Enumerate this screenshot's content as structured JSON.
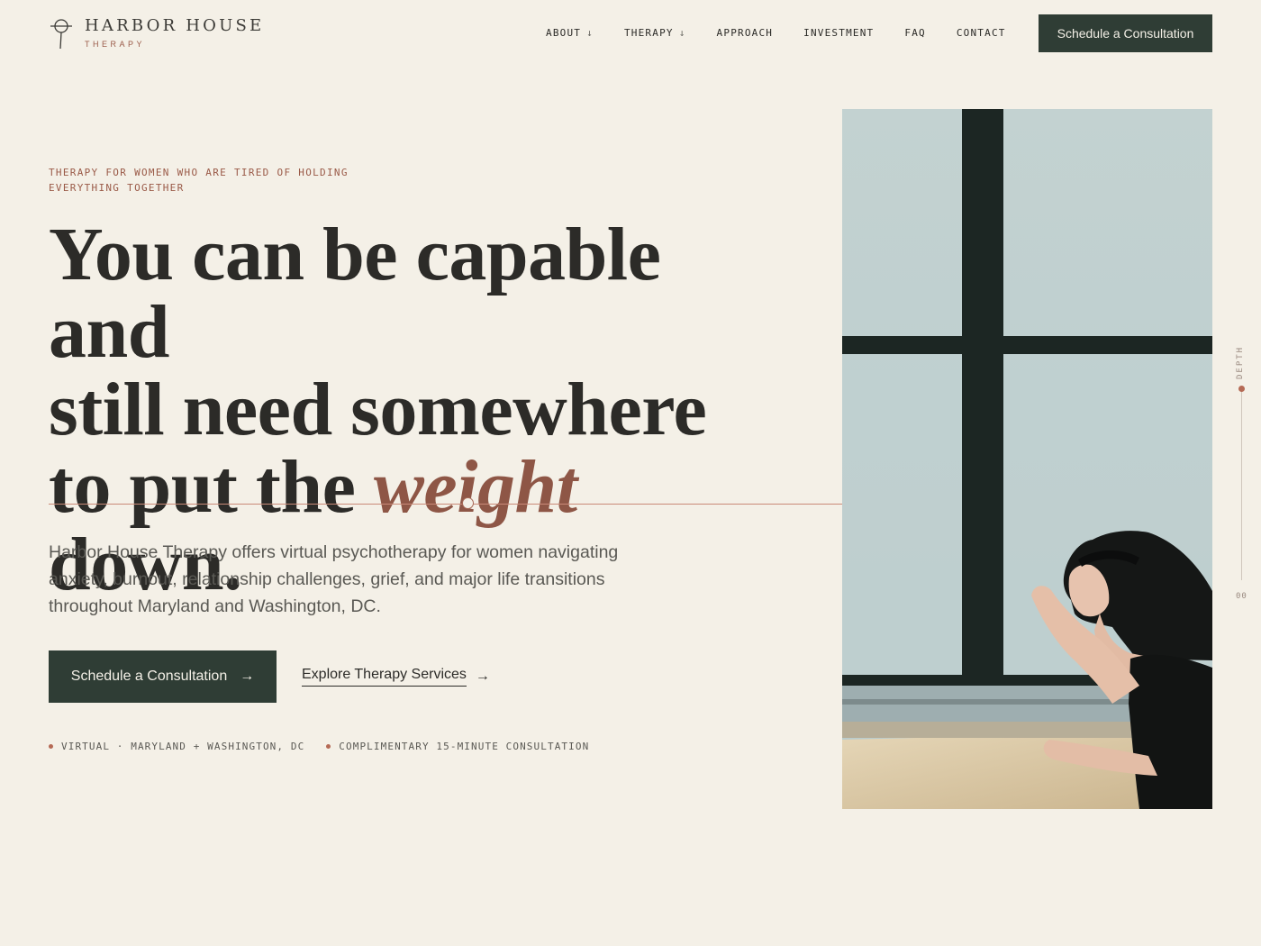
{
  "brand": {
    "name": "HARBOR HOUSE",
    "tagline": "THERAPY"
  },
  "nav": {
    "items": [
      {
        "label": "ABOUT",
        "icon": "arrow-down-icon"
      },
      {
        "label": "THERAPY",
        "icon": "arrow-down-icon"
      },
      {
        "label": "APPROACH"
      },
      {
        "label": "INVESTMENT"
      },
      {
        "label": "FAQ"
      },
      {
        "label": "CONTACT"
      }
    ],
    "cta_label": "Schedule a Consultation"
  },
  "hero": {
    "eyebrow": "THERAPY FOR WOMEN WHO ARE TIRED OF HOLDING EVERYTHING TOGETHER",
    "headline_line1": "You can be capable and",
    "headline_line2": "still need somewhere",
    "headline_line3_pre": "to put the ",
    "headline_emphasis": "weight",
    "headline_line3_post": " down.",
    "body": "Harbor House Therapy offers virtual psychotherapy for women navigating anxiety, burnout, relationship challenges, grief, and major life transitions throughout Maryland and Washington, DC.",
    "primary_cta": "Schedule a Consultation",
    "secondary_cta": "Explore Therapy Services",
    "meta": [
      "VIRTUAL · MARYLAND + WASHINGTON, DC",
      "COMPLIMENTARY 15-MINUTE CONSULTATION"
    ]
  },
  "depth_indicator": {
    "label": "DEPTH",
    "value": "00"
  },
  "colors": {
    "background": "#f4f0e7",
    "primary_dark": "#2f3d35",
    "accent": "#8e5646",
    "text": "#2c2b28"
  }
}
